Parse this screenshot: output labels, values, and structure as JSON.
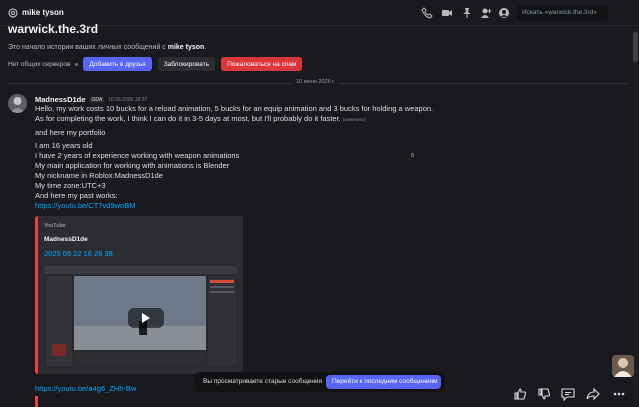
{
  "header": {
    "title": "mike tyson",
    "search_placeholder": "Искать «warwick.the.3rd»"
  },
  "intro": {
    "channel_name": "warwick.the.3rd",
    "text_prefix": "Это начало истории ваших личных сообщений с ",
    "user": "mike tyson",
    "text_suffix": ".",
    "no_servers": "Нет общих серверов",
    "add_friend": "Добавить в друзья",
    "block": "Заблокировать",
    "report": "Пожаловаться на спам"
  },
  "date_divider": "10 июня 2026 г.",
  "message": {
    "author": "MadnessD1de",
    "tag": "GDA",
    "timestamp": "10.06.2026 18:37",
    "line1": "Hello, my work costs 10 bucks for a reload animation, 5 bucks for an equip animation and 3 bucks for holding a weapon.",
    "line2": "As for completing the work, I think I can do it in 3-5 days at most, but I'll probably do it faster.",
    "edited": "(изменено)",
    "line3": "and here my portfolio",
    "line4": "I am 16 years old",
    "line5": "I have 2 years of experience working with weapon animations",
    "line6": "My main application for working with animations is Blender",
    "line7": "My nickname in Roblox:MadnessD1de",
    "line8": "My time zone:UTC+3",
    "line9": "And here my past works:",
    "link1": "https://youtu.be/CT7vd9woBM",
    "link2": "https://youtu.be/a4g6_ZHh-Bw"
  },
  "embed": {
    "provider": "YouTube",
    "author": "MadnessD1de",
    "title": "2025 06 22 16 26 38"
  },
  "side_number": "8",
  "jumpbar": {
    "text": "Вы просматриваете старые сообщения",
    "button": "Перейти к последним сообщениям"
  },
  "colors": {
    "accent": "#5865f2",
    "danger": "#da373c",
    "link": "#00a8fc",
    "background": "#1a1a1e"
  },
  "icons": [
    "at-icon",
    "phone-icon",
    "video-icon",
    "pin-icon",
    "add-friend-icon",
    "profile-icon",
    "like-icon",
    "dislike-icon",
    "comment-icon",
    "share-icon",
    "more-icon"
  ]
}
